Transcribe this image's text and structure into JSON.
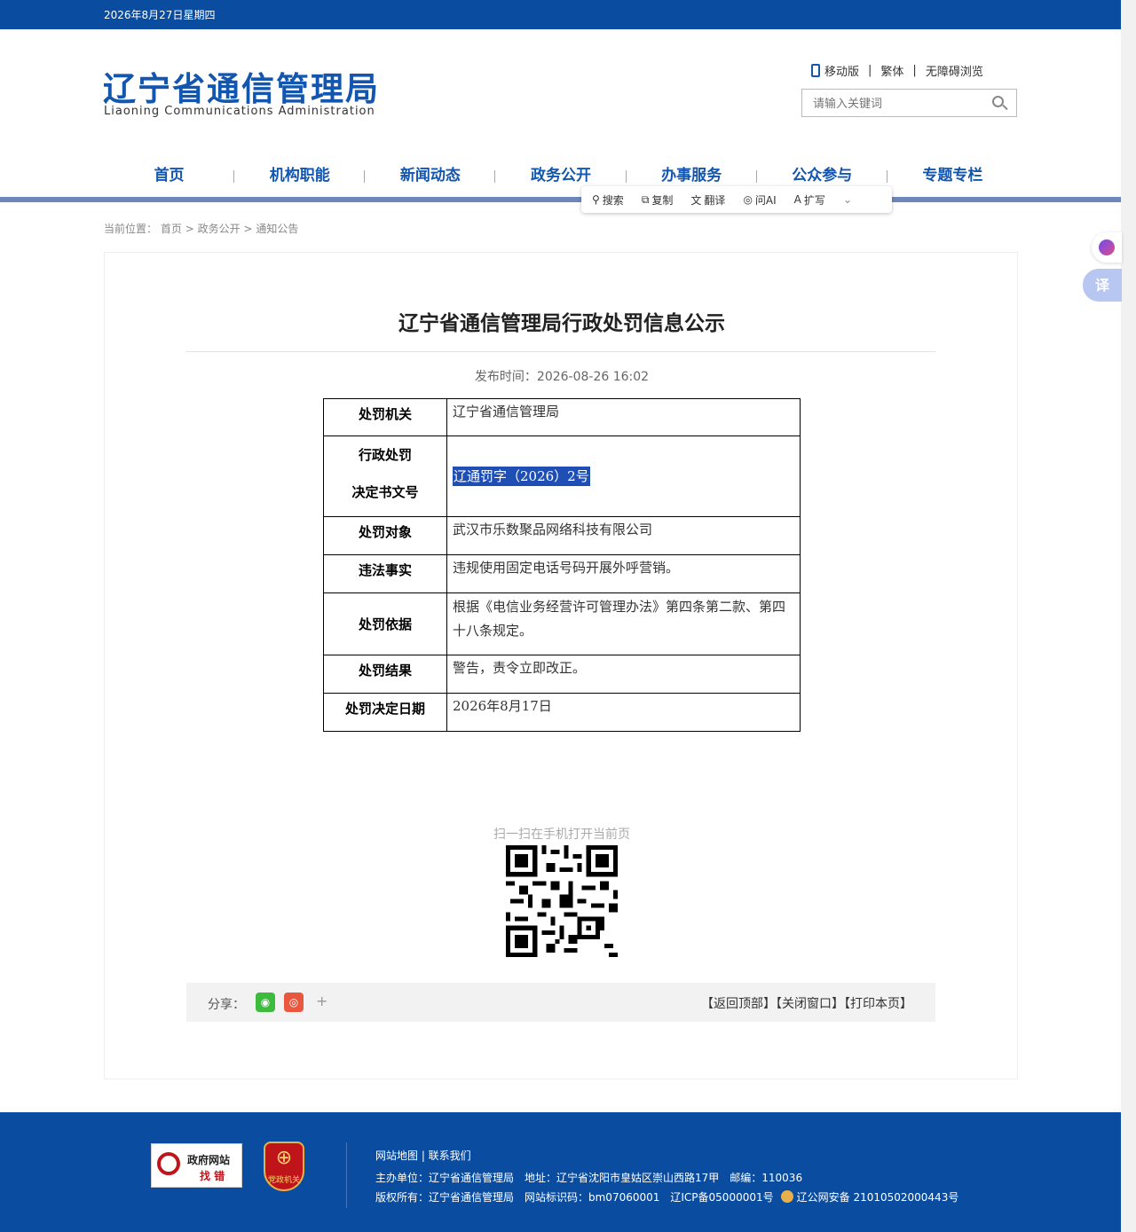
{
  "topbar": {
    "date": "2026年8月27日星期四"
  },
  "header": {
    "logo_cn": "辽宁省通信管理局",
    "logo_en": "Liaoning Communications Administration",
    "tools": [
      "移动版",
      "繁体",
      "无障碍浏览"
    ],
    "search_placeholder": "请输入关键词"
  },
  "nav": [
    "首页",
    "机构职能",
    "新闻动态",
    "政务公开",
    "办事服务",
    "公众参与",
    "专题专栏"
  ],
  "popbar": [
    {
      "icon": "search-icon",
      "label": "搜索"
    },
    {
      "icon": "copy-icon",
      "label": "复制"
    },
    {
      "icon": "translate-icon",
      "label": "翻译"
    },
    {
      "icon": "ai-icon",
      "label": "问AI"
    },
    {
      "icon": "write-icon",
      "label": "扩写"
    }
  ],
  "breadcrumb": {
    "label": "当前位置：",
    "items": [
      "首页",
      "政务公开",
      "通知公告"
    ],
    "sep": ">"
  },
  "article": {
    "title": "辽宁省通信管理局行政处罚信息公示",
    "pub_label": "发布时间：",
    "pub_time": "2026-08-26 16:02",
    "rows": [
      {
        "k": "处罚机关",
        "v": "辽宁省通信管理局"
      },
      {
        "k1": "行政处罚",
        "k2": "决定书文号",
        "v": "辽通罚字（2026）2号"
      },
      {
        "k": "处罚对象",
        "v": "武汉市乐数聚品网络科技有限公司"
      },
      {
        "k": "违法事实",
        "v": "违规使用固定电话号码开展外呼营销。"
      },
      {
        "k": "处罚依据",
        "v": "根据《电信业务经营许可管理办法》第四条第二款、第四十八条规定。"
      },
      {
        "k": "处罚结果",
        "v": "警告，责令立即改正。"
      },
      {
        "k": "处罚决定日期",
        "v": "2026年8月17日"
      }
    ],
    "qr_text": "扫一扫在手机打开当前页"
  },
  "share": {
    "label": "分享：",
    "plus": "+",
    "actions": "【返回顶部】【关闭窗口】【打印本页】"
  },
  "float": {
    "translate": "译"
  },
  "footer": {
    "badge1_line1": "政府网站",
    "badge1_line2": "找 错",
    "badge2_text": "党政机关",
    "links": "网站地图 | 联系我们",
    "line1": "主办单位：辽宁省通信管理局　地址：辽宁省沈阳市皇姑区崇山西路17甲　邮编：110036",
    "line2a": "版权所有：辽宁省通信管理局　网站标识码：bm07060001　辽ICP备05000001号",
    "line2b": "辽公网安备 21010502000443号"
  }
}
